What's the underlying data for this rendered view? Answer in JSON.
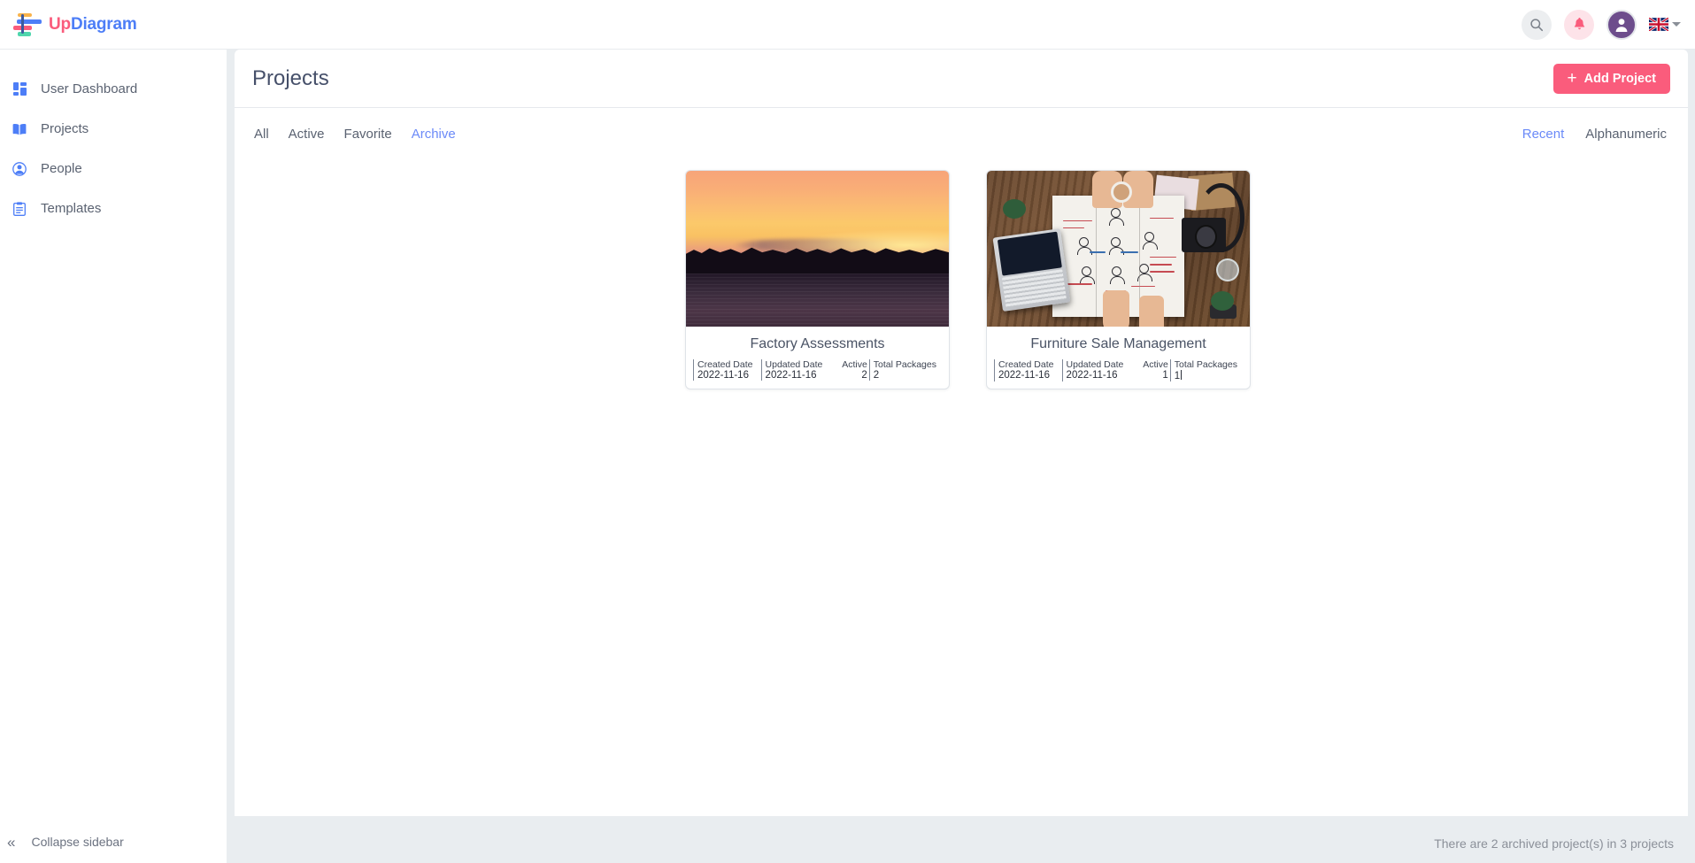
{
  "app": {
    "logo_up": "Up",
    "logo_diagram": "Diagram"
  },
  "topbar": {
    "search_icon": "search-icon",
    "bell_icon": "bell-icon",
    "avatar_icon": "user-avatar-icon",
    "flag_icon": "uk-flag-icon",
    "language_caret": "chevron-down-icon"
  },
  "sidebar": {
    "items": [
      {
        "label": "User Dashboard",
        "icon": "dashboard-grid-icon"
      },
      {
        "label": "Projects",
        "icon": "book-icon"
      },
      {
        "label": "People",
        "icon": "person-circle-icon"
      },
      {
        "label": "Templates",
        "icon": "clipboard-icon"
      }
    ],
    "collapse_label": "Collapse sidebar",
    "collapse_icon": "double-chevron-left-icon"
  },
  "header": {
    "title": "Projects",
    "add_button": "Add Project",
    "add_icon": "plus-icon"
  },
  "tabs": {
    "items": [
      {
        "label": "All",
        "active": false
      },
      {
        "label": "Active",
        "active": false
      },
      {
        "label": "Favorite",
        "active": false
      },
      {
        "label": "Archive",
        "active": true
      }
    ]
  },
  "sorts": {
    "items": [
      {
        "label": "Recent",
        "active": true
      },
      {
        "label": "Alphanumeric",
        "active": false
      }
    ]
  },
  "cards": {
    "meta_headers": {
      "created": "Created Date",
      "updated": "Updated Date",
      "active": "Active",
      "total": "Total Packages"
    },
    "items": [
      {
        "title": "Factory Assessments",
        "thumb": "sunset-lake-photo",
        "created_date": "2022-11-16",
        "updated_date": "2022-11-16",
        "active": "2",
        "total_packages": "2"
      },
      {
        "title": "Furniture Sale Management",
        "thumb": "desk-diagram-workspace-photo",
        "created_date": "2022-11-16",
        "updated_date": "2022-11-16",
        "active": "1",
        "total_packages": "1"
      }
    ]
  },
  "footer": {
    "status": "There are 2 archived project(s) in 3 projects"
  },
  "colors": {
    "accent_pink": "#fa5c7c",
    "accent_blue": "#6b8af8",
    "logo_blue": "#4d7ef7",
    "panel_bg": "#e9edf0"
  }
}
